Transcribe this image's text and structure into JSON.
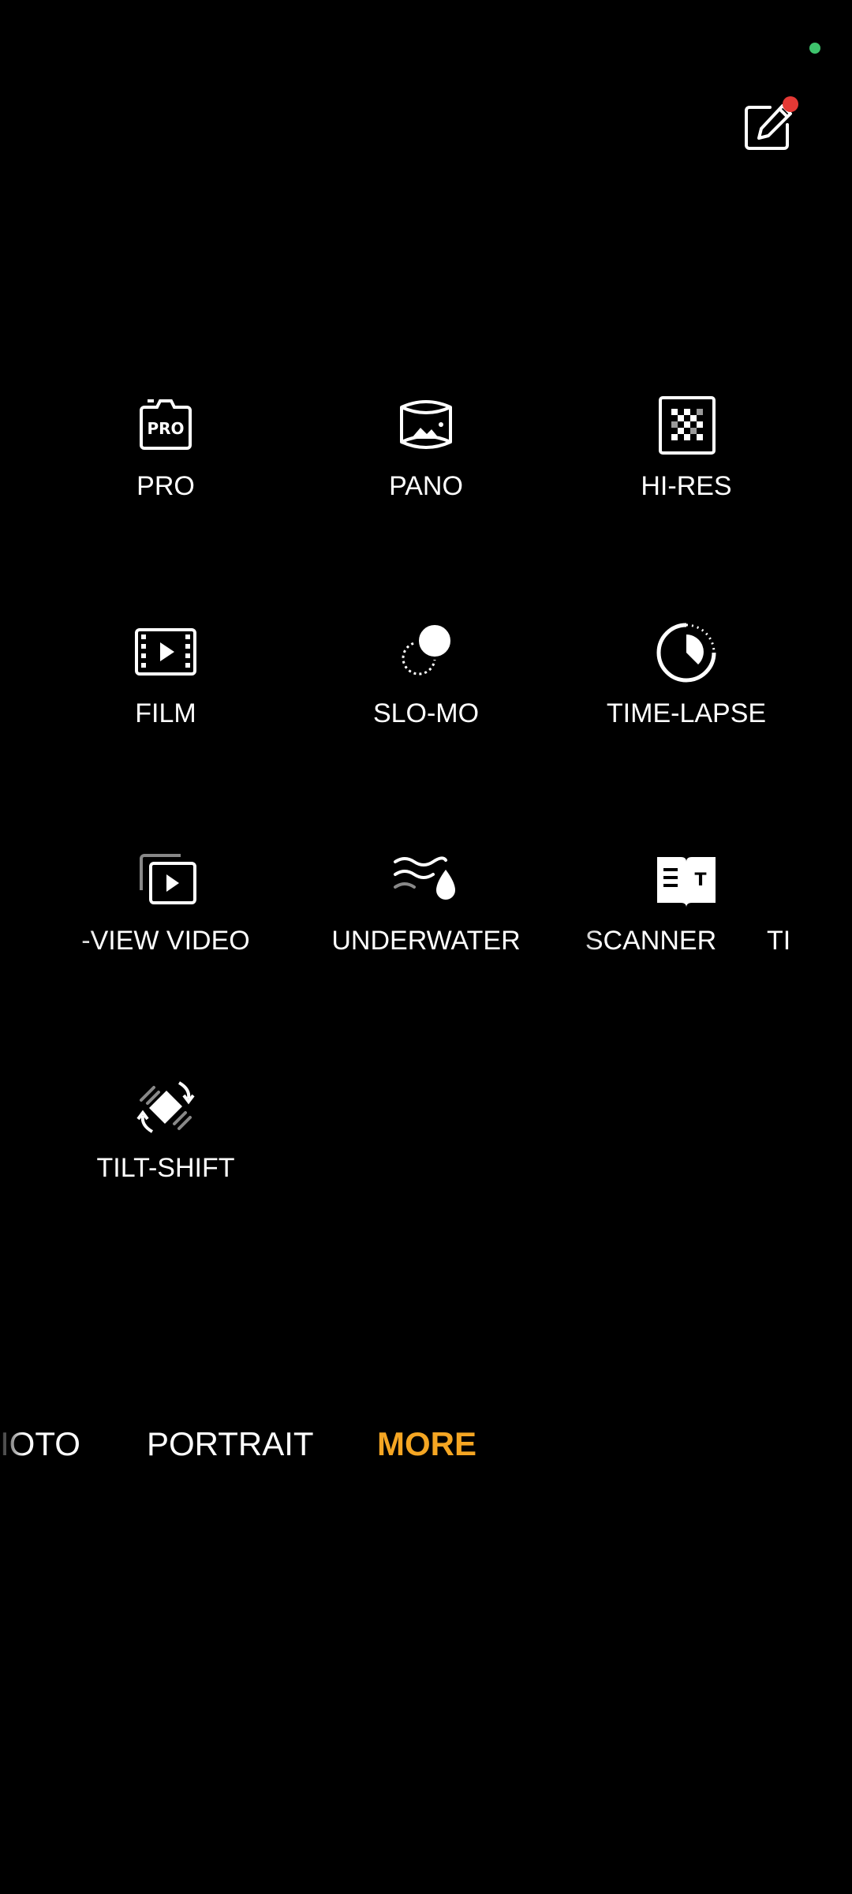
{
  "top_bar": {
    "status_dot_color": "#3ec46d",
    "edit_icon": "edit-square-icon",
    "notification_color": "#e53935"
  },
  "modes": [
    {
      "label": "PRO",
      "icon": "pro-camera-icon"
    },
    {
      "label": "PANO",
      "icon": "panorama-icon"
    },
    {
      "label": "HI-RES",
      "icon": "hi-res-icon"
    },
    {
      "label": "FILM",
      "icon": "film-icon"
    },
    {
      "label": "SLO-MO",
      "icon": "slo-mo-icon"
    },
    {
      "label": "TIME-LAPSE",
      "icon": "time-lapse-icon"
    },
    {
      "label": "-VIEW VIDEO",
      "icon": "dual-view-video-icon"
    },
    {
      "label": "UNDERWATER",
      "icon": "underwater-icon"
    },
    {
      "label": "SCANNER",
      "icon": "scanner-icon"
    },
    {
      "label": "TI",
      "icon": ""
    },
    {
      "label": "TILT-SHIFT",
      "icon": "tilt-shift-icon"
    }
  ],
  "bottom_tabs": [
    {
      "label": "IOTO",
      "active": false
    },
    {
      "label": "PORTRAIT",
      "active": false
    },
    {
      "label": "MORE",
      "active": true
    }
  ],
  "colors": {
    "active_tab": "#f5a623",
    "text": "#ffffff",
    "background": "#000000"
  }
}
